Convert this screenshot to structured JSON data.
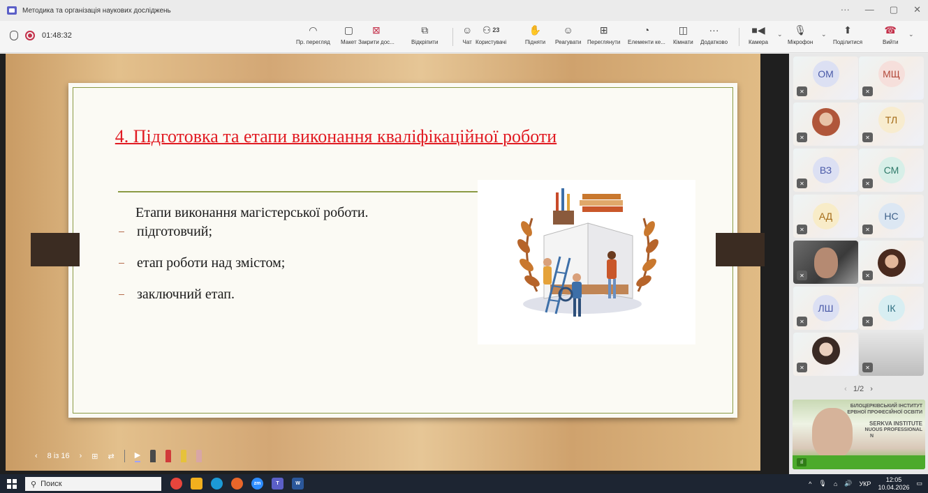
{
  "window": {
    "title": "Методика та організація наукових досліджень"
  },
  "meeting": {
    "timer": "01:48:32"
  },
  "toolbar": {
    "items": [
      {
        "label": "Пр. перегляд",
        "icon": "eye-icon"
      },
      {
        "label": "Макет",
        "icon": "layout-icon"
      },
      {
        "label": "Закрити дос...",
        "icon": "close-share-icon"
      },
      {
        "label": "Відкріпити",
        "icon": "unpin-icon"
      },
      {
        "label": "Чат",
        "icon": "chat-icon"
      },
      {
        "label": "Користувачі",
        "icon": "people-icon",
        "badge": "23"
      },
      {
        "label": "Підняти",
        "icon": "raise-hand-icon"
      },
      {
        "label": "Реагувати",
        "icon": "react-icon"
      },
      {
        "label": "Переглянути",
        "icon": "view-icon"
      },
      {
        "label": "Елементи ке...",
        "icon": "apps-icon"
      },
      {
        "label": "Кімнати",
        "icon": "rooms-icon"
      },
      {
        "label": "Додатково",
        "icon": "more-icon"
      },
      {
        "label": "Камера",
        "icon": "camera-icon"
      },
      {
        "label": "Мікрофон",
        "icon": "microphone-icon"
      },
      {
        "label": "Поділитися",
        "icon": "share-icon"
      },
      {
        "label": "Вийти",
        "icon": "leave-phone-icon",
        "color": "#c4314b"
      }
    ]
  },
  "slide": {
    "title": "4. Підготовка та етапи виконання кваліфікаційної роботи",
    "heading": "Етапи виконання магістерської роботи.",
    "items": [
      "підготовчий;",
      "етап роботи над змістом;",
      "заключний етап."
    ],
    "title_color": "#e11b22"
  },
  "presenter_bar": {
    "page": "8 із 16"
  },
  "participants": [
    {
      "initials": "ОМ",
      "color": "#4a5aa8",
      "bg": "#dce0f3"
    },
    {
      "initials": "МЩ",
      "color": "#b24a3b",
      "bg": "#f6dfdb"
    },
    {
      "initials": "",
      "photo": true
    },
    {
      "initials": "ТЛ",
      "color": "#a46b17",
      "bg": "#f8eccf"
    },
    {
      "initials": "ВЗ",
      "color": "#4a5aa8",
      "bg": "#dce0f3"
    },
    {
      "initials": "СМ",
      "color": "#2f7a6a",
      "bg": "#d7efe8"
    },
    {
      "initials": "АД",
      "color": "#a46b17",
      "bg": "#f8ecc8"
    },
    {
      "initials": "НС",
      "color": "#3c5f88",
      "bg": "#dce7f3"
    },
    {
      "initials": "",
      "photo": true
    },
    {
      "initials": "",
      "photo": true
    },
    {
      "initials": "ЛШ",
      "color": "#4a5aa8",
      "bg": "#dce0f3"
    },
    {
      "initials": "ІК",
      "color": "#2f6f82",
      "bg": "#d8eef2"
    },
    {
      "initials": "",
      "photo": true
    },
    {
      "initials": "",
      "photo": true
    }
  ],
  "gallery": {
    "pager": "1/2"
  },
  "presenter_video": {
    "line1": "БІЛОЦЕРКІВСЬКИЙ ІНСТИТУТ",
    "line2": "ЕРВНОЇ ПРОФЕСІЙНОЇ ОСВІТИ",
    "line3": "SERKVA INSTITUTE",
    "line4": "NUOUS PROFESSIONAL",
    "line5": "N"
  },
  "taskbar": {
    "search_placeholder": "Поиск",
    "lang": "УКР",
    "time": "12:05",
    "date": "10.04.2026"
  }
}
